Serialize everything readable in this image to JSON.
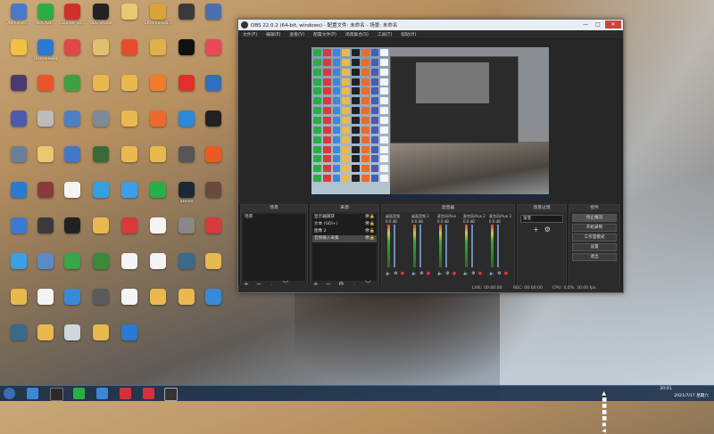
{
  "desktop": {
    "icons": [
      {
        "label": "Administr...",
        "color": "#4b78c9"
      },
      {
        "label": "WeChat...",
        "color": "#2aae44"
      },
      {
        "label": "Counter-Str...",
        "color": "#d0302c"
      },
      {
        "label": "OBS Studio",
        "color": "#222222"
      },
      {
        "label": "",
        "color": "#e8c872"
      },
      {
        "label": "Chrome/Glo...",
        "color": "#d9a43a"
      },
      {
        "label": "",
        "color": "#3a3a3a"
      },
      {
        "label": "",
        "color": "#4c6fb0"
      },
      {
        "label": "",
        "color": "#f0c040"
      },
      {
        "label": "TeamViewer",
        "color": "#2a7ad2"
      },
      {
        "label": "",
        "color": "#e04848"
      },
      {
        "label": "",
        "color": "#e0c070"
      },
      {
        "label": "",
        "color": "#e64c2b"
      },
      {
        "label": "",
        "color": "#e0b14a"
      },
      {
        "label": "",
        "color": "#111111"
      },
      {
        "label": "",
        "color": "#e9495a"
      },
      {
        "label": "",
        "color": "#4a3a70"
      },
      {
        "label": "",
        "color": "#e9552b"
      },
      {
        "label": "",
        "color": "#3da042"
      },
      {
        "label": "",
        "color": "#e9b950"
      },
      {
        "label": "",
        "color": "#e9b950"
      },
      {
        "label": "",
        "color": "#f07a2e"
      },
      {
        "label": "",
        "color": "#e0302c"
      },
      {
        "label": "",
        "color": "#2d6fc2"
      },
      {
        "label": "",
        "color": "#4b5bb0"
      },
      {
        "label": "",
        "color": "#bcbcbc"
      },
      {
        "label": "",
        "color": "#4e7fc2"
      },
      {
        "label": "",
        "color": "#7f8a99"
      },
      {
        "label": "",
        "color": "#e9b950"
      },
      {
        "label": "",
        "color": "#ee6a2a"
      },
      {
        "label": "",
        "color": "#2b88dd"
      },
      {
        "label": "",
        "color": "#222222"
      },
      {
        "label": "",
        "color": "#6a7f99"
      },
      {
        "label": "",
        "color": "#e9c870"
      },
      {
        "label": "",
        "color": "#4278c8"
      },
      {
        "label": "",
        "color": "#3a6a3a"
      },
      {
        "label": "",
        "color": "#e9b950"
      },
      {
        "label": "",
        "color": "#e9b950"
      },
      {
        "label": "",
        "color": "#555555"
      },
      {
        "label": "",
        "color": "#ec5a22"
      },
      {
        "label": "",
        "color": "#2a7ad2"
      },
      {
        "label": "",
        "color": "#8a3a3a"
      },
      {
        "label": "",
        "color": "#f4f4f4"
      },
      {
        "label": "",
        "color": "#34a0e0"
      },
      {
        "label": "",
        "color": "#3aa0e8"
      },
      {
        "label": "",
        "color": "#26b04a"
      },
      {
        "label": "Steam",
        "color": "#1b2838"
      },
      {
        "label": "",
        "color": "#6a4a3a"
      },
      {
        "label": "",
        "color": "#3a7ad2"
      },
      {
        "label": "",
        "color": "#3a3a3a"
      },
      {
        "label": "",
        "color": "#222222"
      },
      {
        "label": "",
        "color": "#e9b950"
      },
      {
        "label": "",
        "color": "#d83a3a"
      },
      {
        "label": "",
        "color": "#f4f4f4"
      },
      {
        "label": "",
        "color": "#888888"
      },
      {
        "label": "",
        "color": "#d83a3a"
      },
      {
        "label": "",
        "color": "#3aa0e8"
      },
      {
        "label": "",
        "color": "#5a8ac8"
      },
      {
        "label": "",
        "color": "#36a84a"
      },
      {
        "label": "",
        "color": "#3a8a3a"
      },
      {
        "label": "",
        "color": "#f4f4f4"
      },
      {
        "label": "",
        "color": "#f4f4f4"
      },
      {
        "label": "",
        "color": "#3a6a8a"
      },
      {
        "label": "",
        "color": "#e9b950"
      },
      {
        "label": "",
        "color": "#e9b950"
      },
      {
        "label": "",
        "color": "#f4f4f4"
      },
      {
        "label": "",
        "color": "#3a88d8"
      },
      {
        "label": "",
        "color": "#5a5a5a"
      },
      {
        "label": "",
        "color": "#f4f4f4"
      },
      {
        "label": "",
        "color": "#e9b950"
      },
      {
        "label": "",
        "color": "#e9b950"
      },
      {
        "label": "",
        "color": "#3a88d8"
      },
      {
        "label": "",
        "color": "#3a6a8a"
      },
      {
        "label": "",
        "color": "#e9b950"
      },
      {
        "label": "",
        "color": "#cfd6dd"
      },
      {
        "label": "",
        "color": "#e9b950"
      },
      {
        "label": "",
        "color": "#2a7ad2"
      }
    ]
  },
  "obs": {
    "title": "OBS 22.0.2 (64-bit, windows) - 配置文件: 未命名 - 场景: 未命名",
    "menu": [
      "文件(F)",
      "编辑(E)",
      "查看(V)",
      "配置文件(P)",
      "场景集合(S)",
      "工具(T)",
      "帮助(H)"
    ],
    "docks": {
      "scenes": {
        "title": "场景",
        "items": [
          "场景"
        ]
      },
      "sources": {
        "title": "来源",
        "items": [
          "显示器捕获",
          "文本 (GDI+)",
          "图像 2",
          "音频输入采集"
        ]
      },
      "mixer": {
        "title": "混音器",
        "channels": [
          {
            "name": "桌面音频",
            "db": "0.0 dB"
          },
          {
            "name": "桌面音频 2",
            "db": "0.0 dB"
          },
          {
            "name": "麦克风/Aux",
            "db": "0.0 dB"
          },
          {
            "name": "麦克风/Aux 2",
            "db": "0.0 dB"
          },
          {
            "name": "麦克风/Aux 3",
            "db": "0.0 dB"
          }
        ]
      },
      "transitions": {
        "title": "场景过渡",
        "selected": "渐变",
        "plus": "+",
        "gear": "⚙"
      },
      "controls": {
        "title": "控件",
        "buttons": [
          "停止推流",
          "开始录制",
          "工作室模式",
          "设置",
          "退出"
        ]
      }
    },
    "status": {
      "live": "LIVE: 00:00:00",
      "rec": "REC: 00:00:00",
      "cpu": "CPU: 4.0%, 30.00 fps"
    }
  },
  "taskbar": {
    "clock_time": "20:01",
    "clock_date": "2021/7/17 星期六",
    "start_icon": "windows-logo-icon"
  }
}
